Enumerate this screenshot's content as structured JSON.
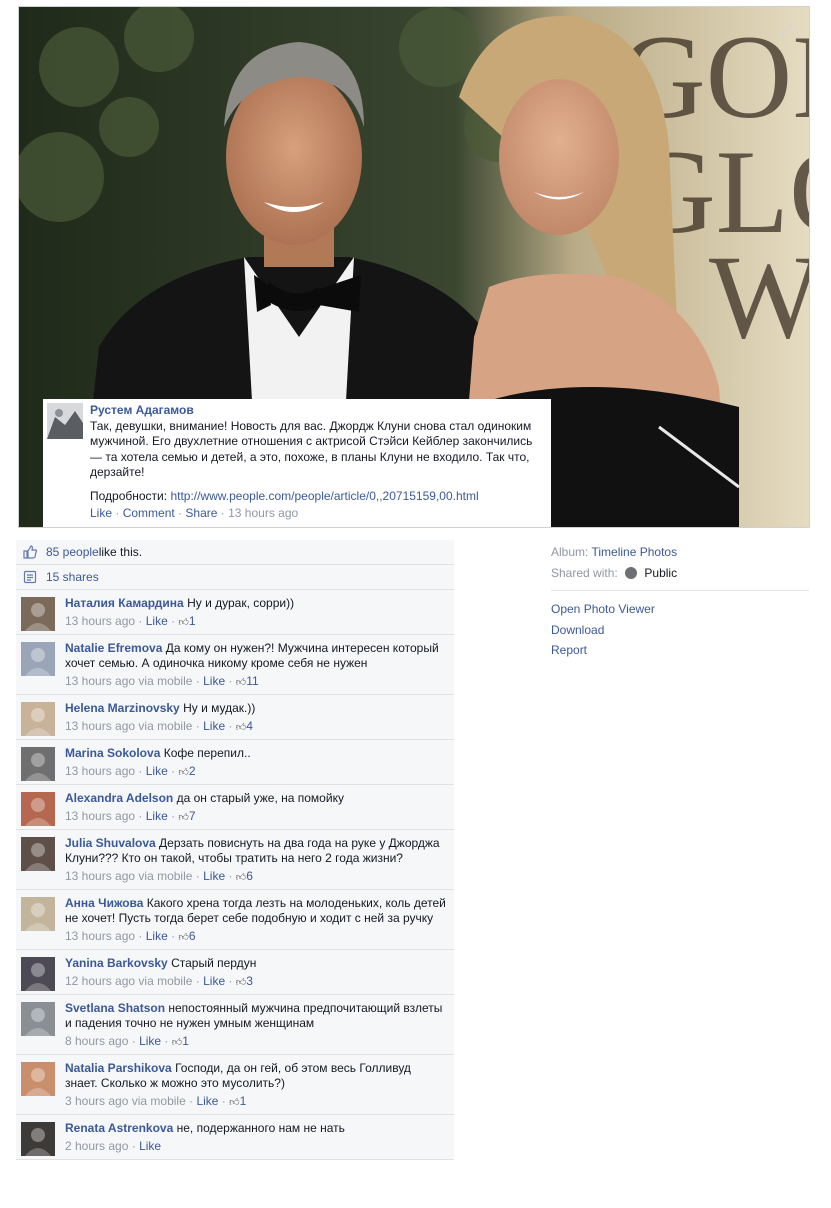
{
  "post": {
    "author": "Рустем Адагамов",
    "text": "Так, девушки, внимание! Новость для вас. Джордж Клуни снова стал одиноким мужчиной. Его двухлетние отношения с актрисой Стэйси Кейблер закончились — та хотела семью и детей, а это, похоже, в планы Клуни не входило. Так что, дерзайте!",
    "more_label": "Подробности:",
    "link": "http://www.people.com/people/article/0,,20715159,00.html",
    "like": "Like",
    "comment": "Comment",
    "share": "Share",
    "time": "13 hours ago"
  },
  "feedback": {
    "likes": "85 people like this.",
    "likes_count": "85 people",
    "likes_suffix": " like this.",
    "shares": "15 shares"
  },
  "comments": [
    {
      "name": "Наталия Камардина",
      "text": "Ну и дурак, сорри))",
      "time": "13 hours ago",
      "via": "",
      "like": "Like",
      "likes": "1"
    },
    {
      "name": "Natalie Efremova",
      "text": "Да кому он нужен?! Мужчина интересен который хочет семью. А одиночка никому кроме себя не нужен",
      "time": "13 hours ago",
      "via": "via mobile",
      "like": "Like",
      "likes": "11"
    },
    {
      "name": "Helena Marzinovsky",
      "text": "Ну и мудак.))",
      "time": "13 hours ago",
      "via": "via mobile",
      "like": "Like",
      "likes": "4"
    },
    {
      "name": "Marina Sokolova",
      "text": "Кофе перепил..",
      "time": "13 hours ago",
      "via": "",
      "like": "Like",
      "likes": "2"
    },
    {
      "name": "Alexandra Adelson",
      "text": "да он старый уже, на помойку",
      "time": "13 hours ago",
      "via": "",
      "like": "Like",
      "likes": "7"
    },
    {
      "name": "Julia Shuvalova",
      "text": "Дерзать повиснуть на два года на руке у Джорджа Клуни??? Кто он такой, чтобы тратить на него 2 года жизни?",
      "time": "13 hours ago",
      "via": "via mobile",
      "like": "Like",
      "likes": "6"
    },
    {
      "name": "Анна Чижова",
      "text": "Какого хрена тогда лезть на молоденьких, коль детей не хочет! Пусть тогда берет себе подобную и ходит с ней за ручку",
      "time": "13 hours ago",
      "via": "",
      "like": "Like",
      "likes": "6"
    },
    {
      "name": "Yanina Barkovsky",
      "text": "Старый пердун",
      "time": "12 hours ago",
      "via": "via mobile",
      "like": "Like",
      "likes": "3"
    },
    {
      "name": "Svetlana Shatson",
      "text": "непостоянный мужчина предпочитающий взлеты и падения точно не нужен умным женщинам",
      "time": "8 hours ago",
      "via": "",
      "like": "Like",
      "likes": "1"
    },
    {
      "name": "Natalia Parshikova",
      "text": "Господи, да он гей, об этом весь Голливуд знает. Сколько ж можно это мусолить?)",
      "time": "3 hours ago",
      "via": "via mobile",
      "like": "Like",
      "likes": "1"
    },
    {
      "name": "Renata Astrenkova",
      "text": "не, подержанного нам не нать",
      "time": "2 hours ago",
      "via": "",
      "like": "Like",
      "likes": ""
    }
  ],
  "sidebar": {
    "album_label": "Album:",
    "album_value": "Timeline Photos",
    "shared_label": "Shared with:",
    "shared_value": "Public",
    "links": [
      "Open Photo Viewer",
      "Download",
      "Report"
    ]
  },
  "icons": {
    "expand": "expand-icon",
    "like": "thumbs-up-icon",
    "share": "shares-icon",
    "globe": "globe-icon"
  },
  "colors": {
    "link": "#3b5998",
    "meta": "#9197a3",
    "panel": "#f6f7f9"
  }
}
